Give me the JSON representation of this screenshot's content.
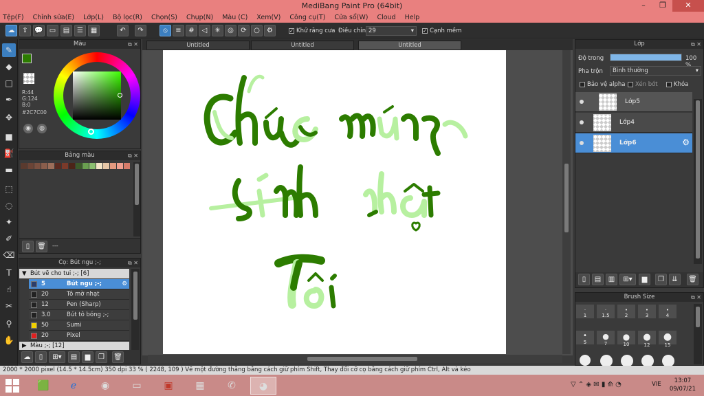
{
  "window": {
    "title": "MediBang Paint Pro (64bit)"
  },
  "menu": [
    "Tệp(F)",
    "Chỉnh sửa(E)",
    "Lớp(L)",
    "Bộ lọc(R)",
    "Chọn(S)",
    "Chụp(N)",
    "Màu (C)",
    "Xem(V)",
    "Công cụ(T)",
    "Cửa sổ(W)",
    "Cloud",
    "Help"
  ],
  "toolbar": {
    "antialias_label": "Khử răng cưa",
    "adjust_label": "Điều chỉnh",
    "adjust_value": "29",
    "soft_edge_label": "Cạnh mềm"
  },
  "tabs": [
    "Untitled",
    "Untitled",
    "Untitled"
  ],
  "color_panel": {
    "title": "Màu",
    "r": "R:44",
    "g": "G:124",
    "b": "B:0",
    "hex": "#2C7C00",
    "fg_color": "#2c7c00"
  },
  "palette_panel": {
    "title": "Bảng màu",
    "swatches": [
      "#5a3a2e",
      "#6b4436",
      "#7a5040",
      "#8a5e4c",
      "#9c6e5a",
      "#5a2a20",
      "#7b3a2a",
      "#4c2418",
      "#3c5a2a",
      "#6aa050",
      "#8cc070",
      "#f5e6c8",
      "#e9c9a8",
      "#e69a80",
      "#f2a090",
      "#d87c6a"
    ],
    "footer_label": "---"
  },
  "brush_panel": {
    "title": "Cọ: Bút ngu ;-;",
    "group_label": "Bút vẽ cho tui ;-; [6]",
    "group2_label": "Màu ;-; [12]",
    "items": [
      {
        "size": "5",
        "name": "Bút ngu ;-;",
        "color": "#2c3e6a"
      },
      {
        "size": "20",
        "name": "Tô mờ nhạt",
        "color": "#222222"
      },
      {
        "size": "12",
        "name": "Pen (Sharp)",
        "color": "#222222"
      },
      {
        "size": "3.0",
        "name": "Bút tô bóng ;-;",
        "color": "#222222"
      },
      {
        "size": "50",
        "name": "Sumi",
        "color": "#f0d000"
      },
      {
        "size": "20",
        "name": "Pixel",
        "color": "#e02020"
      }
    ]
  },
  "layer_panel": {
    "title": "Lớp",
    "opacity_label": "Độ trong",
    "opacity_value": "100 %",
    "opacity_fraction": 1.0,
    "blend_label": "Pha trộn",
    "blend_value": "Bình thường",
    "protect_alpha": "Bảo vệ alpha",
    "clip": "Xén bớt",
    "lock": "Khóa",
    "layers": [
      {
        "name": "Lớp5"
      },
      {
        "name": "Lớp4"
      },
      {
        "name": "Lớp6"
      }
    ]
  },
  "brush_size_panel": {
    "title": "Brush Size",
    "sizes": [
      "1",
      "1.5",
      "2",
      "3",
      "4",
      "5",
      "7",
      "10",
      "12",
      "15"
    ]
  },
  "status": {
    "text": "2000 * 2000 pixel   (14.5 * 14.5cm)   350 dpi   33 %   ( 2248, 109 )   Vẽ một đường thẳng bằng cách giữ phím Shift, Thay đổi cỡ cọ bằng cách giữ phím Ctrl, Alt và kéo"
  },
  "taskbar": {
    "time": "13:07",
    "date": "09/07/21",
    "lang": "VIE"
  }
}
